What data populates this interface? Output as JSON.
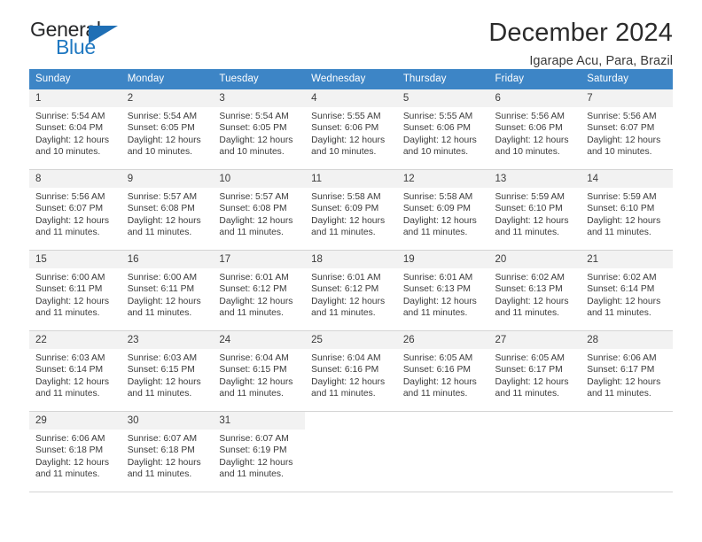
{
  "logo": {
    "word_top": "General",
    "word_bottom": "Blue",
    "triangle_color": "#1f6fb5",
    "blue_color": "#1f78c1"
  },
  "header": {
    "title": "December 2024",
    "subtitle": "Igarape Acu, Para, Brazil"
  },
  "theme": {
    "header_bg": "#3d85c6",
    "daynum_bg": "#f2f2f2",
    "grid_line": "#d4d4d4",
    "text": "#3b3b3b"
  },
  "weekdays": [
    "Sunday",
    "Monday",
    "Tuesday",
    "Wednesday",
    "Thursday",
    "Friday",
    "Saturday"
  ],
  "labels": {
    "sunrise_prefix": "Sunrise: ",
    "sunset_prefix": "Sunset: ",
    "daylight_prefix": "Daylight: "
  },
  "weeks": [
    [
      {
        "day": "1",
        "sunrise": "Sunrise: 5:54 AM",
        "sunset": "Sunset: 6:04 PM",
        "daylight": "Daylight: 12 hours and 10 minutes."
      },
      {
        "day": "2",
        "sunrise": "Sunrise: 5:54 AM",
        "sunset": "Sunset: 6:05 PM",
        "daylight": "Daylight: 12 hours and 10 minutes."
      },
      {
        "day": "3",
        "sunrise": "Sunrise: 5:54 AM",
        "sunset": "Sunset: 6:05 PM",
        "daylight": "Daylight: 12 hours and 10 minutes."
      },
      {
        "day": "4",
        "sunrise": "Sunrise: 5:55 AM",
        "sunset": "Sunset: 6:06 PM",
        "daylight": "Daylight: 12 hours and 10 minutes."
      },
      {
        "day": "5",
        "sunrise": "Sunrise: 5:55 AM",
        "sunset": "Sunset: 6:06 PM",
        "daylight": "Daylight: 12 hours and 10 minutes."
      },
      {
        "day": "6",
        "sunrise": "Sunrise: 5:56 AM",
        "sunset": "Sunset: 6:06 PM",
        "daylight": "Daylight: 12 hours and 10 minutes."
      },
      {
        "day": "7",
        "sunrise": "Sunrise: 5:56 AM",
        "sunset": "Sunset: 6:07 PM",
        "daylight": "Daylight: 12 hours and 10 minutes."
      }
    ],
    [
      {
        "day": "8",
        "sunrise": "Sunrise: 5:56 AM",
        "sunset": "Sunset: 6:07 PM",
        "daylight": "Daylight: 12 hours and 11 minutes."
      },
      {
        "day": "9",
        "sunrise": "Sunrise: 5:57 AM",
        "sunset": "Sunset: 6:08 PM",
        "daylight": "Daylight: 12 hours and 11 minutes."
      },
      {
        "day": "10",
        "sunrise": "Sunrise: 5:57 AM",
        "sunset": "Sunset: 6:08 PM",
        "daylight": "Daylight: 12 hours and 11 minutes."
      },
      {
        "day": "11",
        "sunrise": "Sunrise: 5:58 AM",
        "sunset": "Sunset: 6:09 PM",
        "daylight": "Daylight: 12 hours and 11 minutes."
      },
      {
        "day": "12",
        "sunrise": "Sunrise: 5:58 AM",
        "sunset": "Sunset: 6:09 PM",
        "daylight": "Daylight: 12 hours and 11 minutes."
      },
      {
        "day": "13",
        "sunrise": "Sunrise: 5:59 AM",
        "sunset": "Sunset: 6:10 PM",
        "daylight": "Daylight: 12 hours and 11 minutes."
      },
      {
        "day": "14",
        "sunrise": "Sunrise: 5:59 AM",
        "sunset": "Sunset: 6:10 PM",
        "daylight": "Daylight: 12 hours and 11 minutes."
      }
    ],
    [
      {
        "day": "15",
        "sunrise": "Sunrise: 6:00 AM",
        "sunset": "Sunset: 6:11 PM",
        "daylight": "Daylight: 12 hours and 11 minutes."
      },
      {
        "day": "16",
        "sunrise": "Sunrise: 6:00 AM",
        "sunset": "Sunset: 6:11 PM",
        "daylight": "Daylight: 12 hours and 11 minutes."
      },
      {
        "day": "17",
        "sunrise": "Sunrise: 6:01 AM",
        "sunset": "Sunset: 6:12 PM",
        "daylight": "Daylight: 12 hours and 11 minutes."
      },
      {
        "day": "18",
        "sunrise": "Sunrise: 6:01 AM",
        "sunset": "Sunset: 6:12 PM",
        "daylight": "Daylight: 12 hours and 11 minutes."
      },
      {
        "day": "19",
        "sunrise": "Sunrise: 6:01 AM",
        "sunset": "Sunset: 6:13 PM",
        "daylight": "Daylight: 12 hours and 11 minutes."
      },
      {
        "day": "20",
        "sunrise": "Sunrise: 6:02 AM",
        "sunset": "Sunset: 6:13 PM",
        "daylight": "Daylight: 12 hours and 11 minutes."
      },
      {
        "day": "21",
        "sunrise": "Sunrise: 6:02 AM",
        "sunset": "Sunset: 6:14 PM",
        "daylight": "Daylight: 12 hours and 11 minutes."
      }
    ],
    [
      {
        "day": "22",
        "sunrise": "Sunrise: 6:03 AM",
        "sunset": "Sunset: 6:14 PM",
        "daylight": "Daylight: 12 hours and 11 minutes."
      },
      {
        "day": "23",
        "sunrise": "Sunrise: 6:03 AM",
        "sunset": "Sunset: 6:15 PM",
        "daylight": "Daylight: 12 hours and 11 minutes."
      },
      {
        "day": "24",
        "sunrise": "Sunrise: 6:04 AM",
        "sunset": "Sunset: 6:15 PM",
        "daylight": "Daylight: 12 hours and 11 minutes."
      },
      {
        "day": "25",
        "sunrise": "Sunrise: 6:04 AM",
        "sunset": "Sunset: 6:16 PM",
        "daylight": "Daylight: 12 hours and 11 minutes."
      },
      {
        "day": "26",
        "sunrise": "Sunrise: 6:05 AM",
        "sunset": "Sunset: 6:16 PM",
        "daylight": "Daylight: 12 hours and 11 minutes."
      },
      {
        "day": "27",
        "sunrise": "Sunrise: 6:05 AM",
        "sunset": "Sunset: 6:17 PM",
        "daylight": "Daylight: 12 hours and 11 minutes."
      },
      {
        "day": "28",
        "sunrise": "Sunrise: 6:06 AM",
        "sunset": "Sunset: 6:17 PM",
        "daylight": "Daylight: 12 hours and 11 minutes."
      }
    ],
    [
      {
        "day": "29",
        "sunrise": "Sunrise: 6:06 AM",
        "sunset": "Sunset: 6:18 PM",
        "daylight": "Daylight: 12 hours and 11 minutes."
      },
      {
        "day": "30",
        "sunrise": "Sunrise: 6:07 AM",
        "sunset": "Sunset: 6:18 PM",
        "daylight": "Daylight: 12 hours and 11 minutes."
      },
      {
        "day": "31",
        "sunrise": "Sunrise: 6:07 AM",
        "sunset": "Sunset: 6:19 PM",
        "daylight": "Daylight: 12 hours and 11 minutes."
      },
      {
        "day": "",
        "sunrise": "",
        "sunset": "",
        "daylight": ""
      },
      {
        "day": "",
        "sunrise": "",
        "sunset": "",
        "daylight": ""
      },
      {
        "day": "",
        "sunrise": "",
        "sunset": "",
        "daylight": ""
      },
      {
        "day": "",
        "sunrise": "",
        "sunset": "",
        "daylight": ""
      }
    ]
  ]
}
